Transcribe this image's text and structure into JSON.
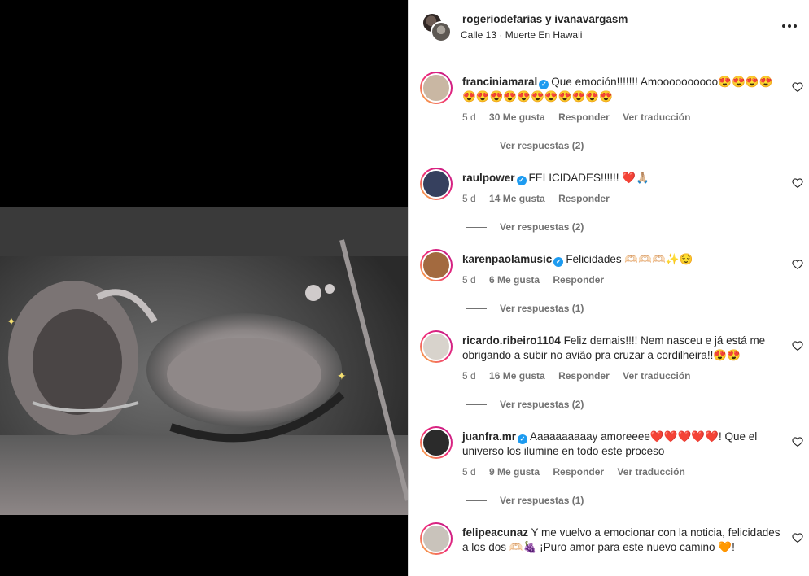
{
  "header": {
    "names": "rogeriodefarias y ivanavargasm",
    "audio": "Calle 13 · Muerte En Hawaii"
  },
  "labels": {
    "reply": "Responder",
    "translate": "Ver traducción"
  },
  "comments": [
    {
      "user": "franciniamaral",
      "verified": true,
      "text": "Que emoción!!!!!!! Amoooooooooo😍😍😍😍😍😍😍😍😍😍😍😍😍😍😍",
      "time": "5 d",
      "likes": "30 Me gusta",
      "translate": true,
      "replies": "Ver respuestas (2)",
      "avatar_color": "#c9b7a3"
    },
    {
      "user": "raulpower",
      "verified": true,
      "text": "FELICIDADES!!!!!! ❤️🙏🏼",
      "time": "5 d",
      "likes": "14 Me gusta",
      "translate": false,
      "replies": "Ver respuestas (2)",
      "avatar_color": "#36405e"
    },
    {
      "user": "karenpaolamusic",
      "verified": true,
      "text": "Felicidades 🫶🏻🫶🏻🫶🏻✨😌",
      "time": "5 d",
      "likes": "6 Me gusta",
      "translate": false,
      "replies": "Ver respuestas (1)",
      "avatar_color": "#a36a3f"
    },
    {
      "user": "ricardo.ribeiro1104",
      "verified": false,
      "text": "Feliz demais!!!! Nem nasceu e já está me obrigando a subir no avião pra cruzar a cordilheira!!😍😍",
      "time": "5 d",
      "likes": "16 Me gusta",
      "translate": true,
      "replies": "Ver respuestas (2)",
      "avatar_color": "#d8d3cc"
    },
    {
      "user": "juanfra.mr",
      "verified": true,
      "text": "Aaaaaaaaaay amoreeee❤️❤️❤️❤️❤️! Que el universo los ilumine en todo este proceso",
      "time": "5 d",
      "likes": "9 Me gusta",
      "translate": true,
      "replies": "Ver respuestas (1)",
      "avatar_color": "#2b2b2b"
    },
    {
      "user": "felipeacunaz",
      "verified": false,
      "text": "Y me vuelvo a emocionar con la noticia, felicidades a los dos 🫶🏻🍇 ¡Puro amor para este nuevo camino 🧡!",
      "time": "",
      "likes": "",
      "translate": false,
      "replies": "",
      "avatar_color": "#c9c3bb"
    }
  ]
}
